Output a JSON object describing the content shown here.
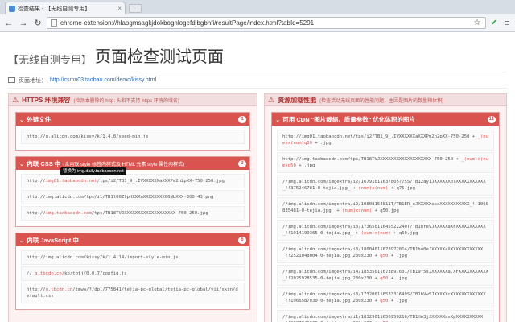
{
  "browser": {
    "tab_title": "检查结果 - 【无线自测专用】",
    "url": "chrome-extension://hlaogmsagkjdokbognlogefdjbgbhfi/resultPage/index.html?tabId=5291"
  },
  "header": {
    "sub": "【无线自测专用】",
    "main": "页面检查测试页面"
  },
  "page_address": {
    "label": "页面地址：",
    "url": "http://csmn03.taobao.com/demo/kissy.html"
  },
  "left_column": {
    "title": "HTTPS 环境兼容",
    "desc": "(检测本删除的 http: 头和不支持 https 环境的域名)",
    "panels": [
      {
        "title": "外链文件",
        "sub": "",
        "count": "1",
        "rows": [
          {
            "pre": "http://g.alicdn.com/kissy/k/1.4.8/seed-min.js",
            "red": "",
            "post": ""
          }
        ]
      },
      {
        "title": "内联 CSS 中",
        "sub": "(含内联 style 标签内样式及 HTML 元素 style 属性内样式)",
        "count": "3",
        "tooltip": "替换为 img.daily.taobaocdn.net",
        "rows": [
          {
            "pre": "http://",
            "red": "img01.taobaocdn.net",
            "post": "/tps/i2/TB1_9_.IVXXXXXXaXXXPm2n2pXX-750-250.jpg"
          },
          {
            "pre": "http://img.alicdn.com/tps/i1/TB1lO0Z9pHXXXaXXXXXXXX06NLXXX-300-43.png",
            "red": "",
            "post": ""
          },
          {
            "pre": "http://",
            "red": "img.taobaocdn.com",
            "post": "/tps/TB18TVJXXXXXXXXXXXXXXXXXXX-750-250.jpg"
          }
        ]
      },
      {
        "title": "内联 JavaScript 中",
        "sub": "",
        "count": "6",
        "rows": [
          {
            "pre": "http://img.alicdn.com/kissy/k/1.4.14/import-style-min.js",
            "red": "",
            "post": ""
          },
          {
            "pre": "// ",
            "red": "g.tbcdn.cn",
            "post": "/kb/tbtj/0.0.7/config.js"
          },
          {
            "pre": "http://",
            "red": "g.tbcdn.cn",
            "post": "/tmww/?/dpl/775841/tejia-pc-global/tejia-pc-global/vii/skin/default.css"
          }
        ]
      }
    ]
  },
  "right_column": {
    "title": "资源加载性能",
    "desc": "(检查活动无线页面的性能问题，主因是图片的数量和体积)",
    "panels": [
      {
        "title": "可用 CDN \"图片裁缩、质量参数\" 优化体积的图片",
        "count": "11",
        "rows": [
          {
            "pre": "http://img01.taobaocdn.net/tps/i2/TB1_9_.IVXXXXXXaXXXPm2n2pXX-750-250 + ",
            "red": "_(num)x(num)q50",
            "post": " + .jpg"
          },
          {
            "pre": "http://img.taobaocdn.com/tps/TB18TVJXXXXXXXXXXXXXXXXXXX-750-250 + ",
            "red": "_(num)x(num)q50",
            "post": " + .jpg"
          },
          {
            "pre": "//img.alicdn.com/imgextra/i2/16791011637805775S/TB12ay1JXXXXXXbTXXXXXXXXXXX_!!375246781-0-tejia.jpg_ + ",
            "red": "(num)x(num)",
            "post": " + q75.jpg"
          },
          {
            "pre": "//img.alicdn.com/imgextra/i2/10808154811T/TB1ER_eJXXXXXaeaXXXXXXXXXXX_!!1060835481-0-tejia.jpg_ + ",
            "red": "(num)x(num)",
            "post": " + q50.jpg"
          },
          {
            "pre": "//img.alicdn.com/imgextra/i3/17365011645522240T/TB1hreVJXXXXXaXFXXXXXXXXXXX_!!1914199365-0-tejia.jpg_ + ",
            "red": "(num)x(num)",
            "post": " + q50.jpg"
          },
          {
            "pre": "//img.alicdn.com/imgextra/i3/18004011673972014/TB1hu0eJXXXXXaXXXXXXXXXXXXX_!!2521048004-0-tejia.jpg_230x230 + ",
            "red": "q50",
            "post": " + .jpg"
          },
          {
            "pre": "//img.alicdn.com/imgextra/i4/18535011673897601/TB19f5sJXXXXXXa.XFXXXXXXXXXXX_!!2025928535-0-tejia.jpg_230x230 + ",
            "red": "q50",
            "post": " + .jpg"
          },
          {
            "pre": "//img.alicdn.com/imgextra/i3/17320011653331649S/TB1hVwSJXXXXXcXXXXXXXXXXXXX_!!1966587030-0-tejia.jpg_230x230 + ",
            "red": "q50",
            "post": " + .jpg"
          },
          {
            "pre": "//img.alicdn.com/imgextra/i1/18329011656950216/TB1Hw3jJXXXXXaxXpXXXXXXXXXX_!!2387848329-0-tejia.jpg_230x230 + ",
            "red": "q50",
            "post": " + .jpg"
          }
        ]
      }
    ]
  }
}
